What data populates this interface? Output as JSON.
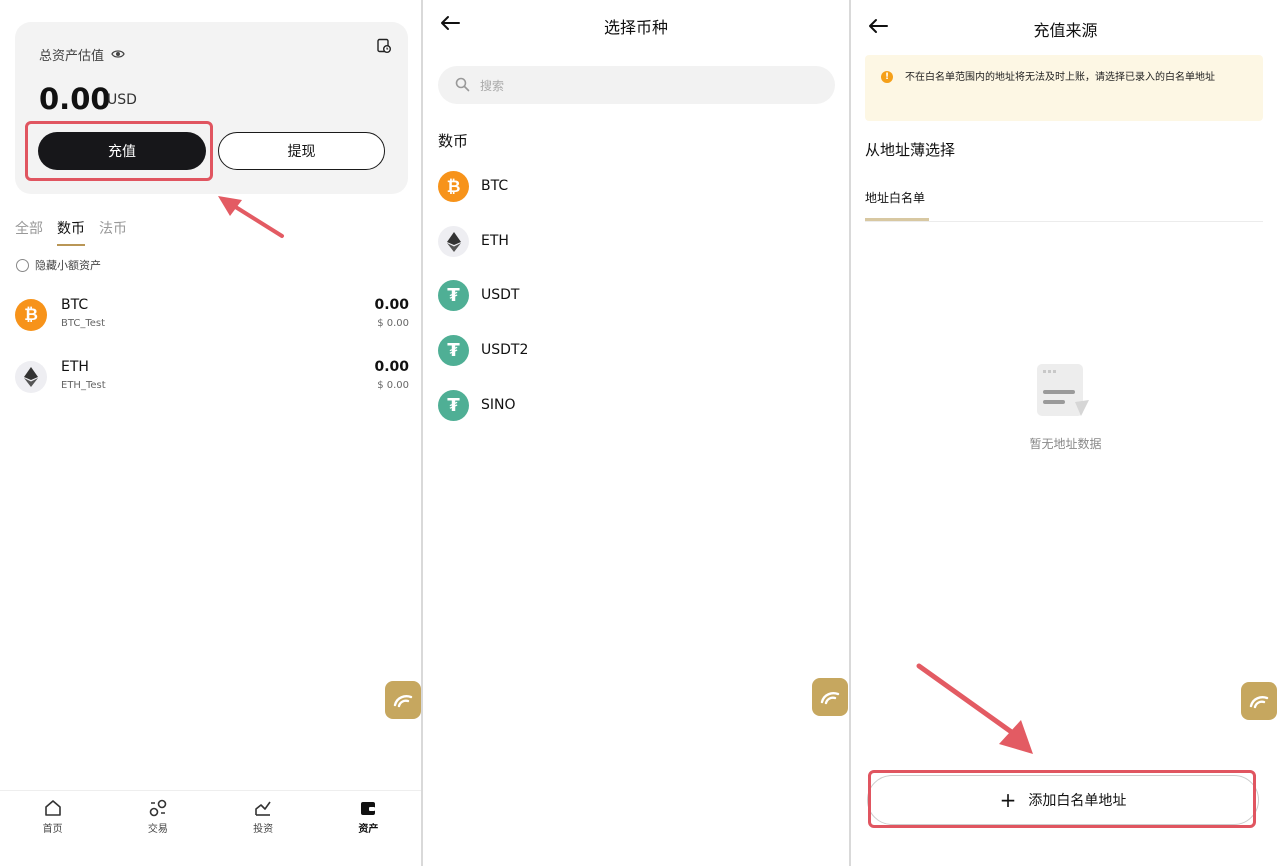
{
  "colors": {
    "accent_gold": "#c6a75f",
    "highlight_red": "#e05560",
    "btc_orange": "#f7931a",
    "tether_green": "#4faf95"
  },
  "panel_assets": {
    "card": {
      "label": "总资产估值",
      "value": "0.00",
      "unit": "USD",
      "deposit_label": "充值",
      "withdraw_label": "提现"
    },
    "tabs": [
      {
        "label": "全部",
        "active": false
      },
      {
        "label": "数币",
        "active": true
      },
      {
        "label": "法币",
        "active": false
      }
    ],
    "hide_small_label": "隐藏小额资产",
    "coins": [
      {
        "symbol": "BTC",
        "name": "BTC_Test",
        "amount": "0.00",
        "usd": "$ 0.00",
        "icon": "btc-icon"
      },
      {
        "symbol": "ETH",
        "name": "ETH_Test",
        "amount": "0.00",
        "usd": "$ 0.00",
        "icon": "eth-icon"
      }
    ],
    "nav": [
      {
        "label": "首页",
        "icon": "home-icon",
        "active": false
      },
      {
        "label": "交易",
        "icon": "trade-icon",
        "active": false
      },
      {
        "label": "投资",
        "icon": "invest-icon",
        "active": false
      },
      {
        "label": "资产",
        "icon": "wallet-icon",
        "active": true
      }
    ]
  },
  "panel_select": {
    "title": "选择币种",
    "search_placeholder": "搜索",
    "section_title": "数币",
    "coins": [
      {
        "symbol": "BTC",
        "icon": "btc-icon"
      },
      {
        "symbol": "ETH",
        "icon": "eth-icon"
      },
      {
        "symbol": "USDT",
        "icon": "tether-icon"
      },
      {
        "symbol": "USDT2",
        "icon": "tether-icon"
      },
      {
        "symbol": "SINO",
        "icon": "tether-icon"
      }
    ]
  },
  "panel_source": {
    "title": "充值来源",
    "notice": "不在白名单范围内的地址将无法及时上账，请选择已录入的白名单地址",
    "subtitle": "从地址薄选择",
    "tab_label": "地址白名单",
    "empty_text": "暂无地址数据",
    "add_label": "添加白名单地址"
  }
}
